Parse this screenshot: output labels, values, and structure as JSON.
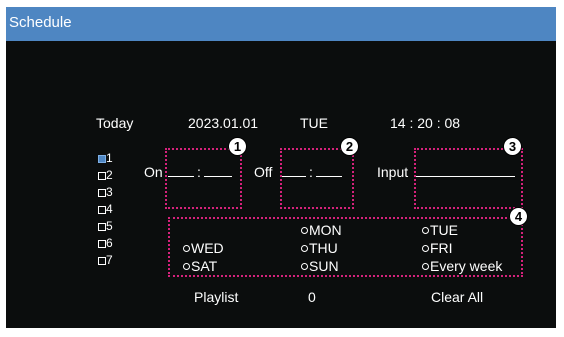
{
  "header": {
    "title": "Schedule"
  },
  "datetime": {
    "day_label": "Today",
    "date": "2023.01.01",
    "weekday": "TUE",
    "time": "14 : 20 : 08"
  },
  "slots": [
    {
      "label": "1",
      "selected": true
    },
    {
      "label": "2",
      "selected": false
    },
    {
      "label": "3",
      "selected": false
    },
    {
      "label": "4",
      "selected": false
    },
    {
      "label": "5",
      "selected": false
    },
    {
      "label": "6",
      "selected": false
    },
    {
      "label": "7",
      "selected": false
    }
  ],
  "on_time": {
    "label": "On",
    "separator": ":"
  },
  "off_time": {
    "label": "Off",
    "separator": ":"
  },
  "input": {
    "label": "Input"
  },
  "days": {
    "mon": "MON",
    "tue": "TUE",
    "wed": "WED",
    "thu": "THU",
    "fri": "FRI",
    "sat": "SAT",
    "sun": "SUN",
    "every_week": "Every week"
  },
  "playlist": {
    "label": "Playlist",
    "value": "0"
  },
  "clear_all": "Clear All",
  "callouts": [
    "1",
    "2",
    "3",
    "4"
  ],
  "colors": {
    "header": "#4e86c2",
    "background": "#0b0d0d",
    "callout": "#d5227b",
    "selection": "#4e86c2"
  }
}
